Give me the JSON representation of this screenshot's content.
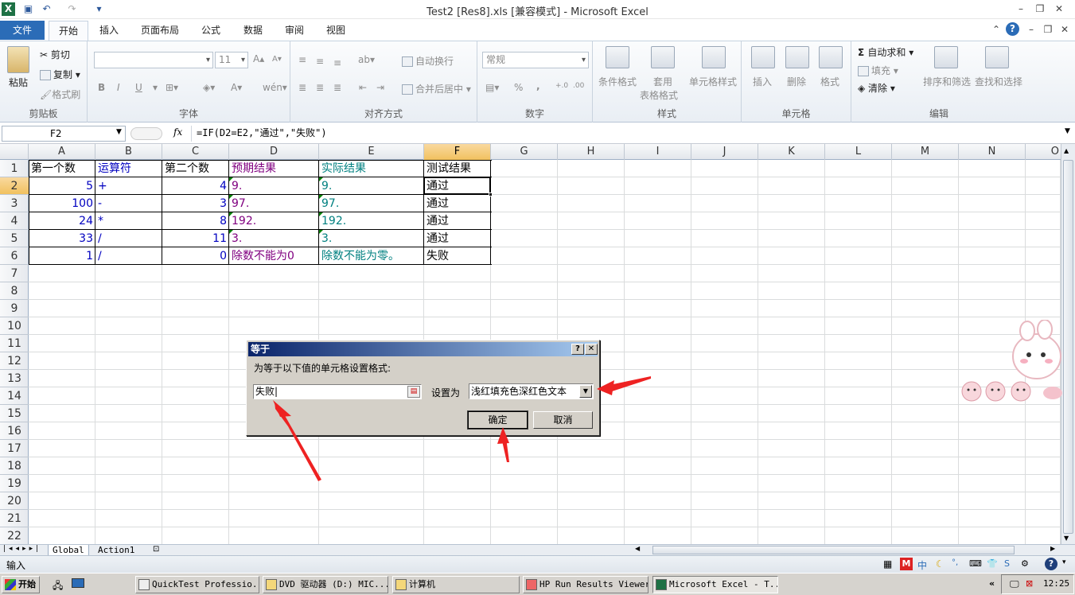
{
  "window": {
    "title": "Test2 [Res8].xls  [兼容模式]  -  Microsoft Excel"
  },
  "ribbon": {
    "tabs": [
      "文件",
      "开始",
      "插入",
      "页面布局",
      "公式",
      "数据",
      "审阅",
      "视图"
    ],
    "clipboard": {
      "label": "剪贴板",
      "paste": "粘贴",
      "cut": "剪切",
      "copy": "复制",
      "format_painter": "格式刷"
    },
    "font": {
      "label": "字体",
      "size": "11",
      "bold": "B",
      "italic": "I",
      "underline": "U"
    },
    "alignment": {
      "label": "对齐方式",
      "wrap": "自动换行",
      "merge": "合并后居中"
    },
    "number": {
      "label": "数字",
      "format": "常规",
      "percent": "%",
      "comma": ","
    },
    "styles": {
      "label": "样式",
      "conditional": "条件格式",
      "table_line1": "套用",
      "table_line2": "表格格式",
      "cell_styles": "单元格样式"
    },
    "cells": {
      "label": "单元格",
      "insert": "插入",
      "delete": "删除",
      "format": "格式"
    },
    "editing": {
      "label": "编辑",
      "autosum": "自动求和",
      "fill": "填充",
      "clear": "清除",
      "sort": "排序和筛选",
      "find": "查找和选择"
    }
  },
  "formula_bar": {
    "name_box": "F2",
    "fx": "fx",
    "formula": "=IF(D2=E2,\"通过\",\"失败\")"
  },
  "columns": [
    "A",
    "B",
    "C",
    "D",
    "E",
    "F",
    "G",
    "H",
    "I",
    "J",
    "K",
    "L",
    "M",
    "N",
    "O"
  ],
  "rows": [
    "1",
    "2",
    "3",
    "4",
    "5",
    "6",
    "7",
    "8",
    "9",
    "10",
    "11",
    "12",
    "13",
    "14",
    "15",
    "16",
    "17",
    "18",
    "19",
    "20",
    "21",
    "22"
  ],
  "table": {
    "headers": [
      "第一个数",
      "运算符",
      "第二个数",
      "预期结果",
      "实际结果",
      "测试结果"
    ],
    "data": [
      [
        "5",
        "+",
        "4",
        "9.",
        "9.",
        "通过"
      ],
      [
        "100",
        "-",
        "3",
        "97.",
        "97.",
        "通过"
      ],
      [
        "24",
        "*",
        "8",
        "192.",
        "192.",
        "通过"
      ],
      [
        "33",
        "/",
        "11",
        "3.",
        "3.",
        "通过"
      ],
      [
        "1",
        "/",
        "0",
        "除数不能为0",
        "除数不能为零。",
        "失败"
      ]
    ]
  },
  "sheets": {
    "tabs": [
      "Global",
      "Action1"
    ]
  },
  "status": {
    "mode": "输入"
  },
  "dialog": {
    "title": "等于",
    "help": "?",
    "close": "✕",
    "prompt": "为等于以下值的单元格设置格式:",
    "value": "失败",
    "set_as_label": "设置为",
    "format_option": "浅红填充色深红色文本",
    "ok": "确定",
    "cancel": "取消"
  },
  "taskbar": {
    "start": "开始",
    "tasks": [
      "QuickTest Professio...",
      "DVD 驱动器 (D:) MIC...",
      "计算机",
      "HP Run Results Viewer",
      "Microsoft Excel - T..."
    ],
    "clock": "12:25"
  },
  "colors": {
    "accent": "#2b6cb7",
    "selected_header": "#f1c15f",
    "dialog_title": "#0a246a",
    "annotation_arrow": "#ee2222"
  }
}
